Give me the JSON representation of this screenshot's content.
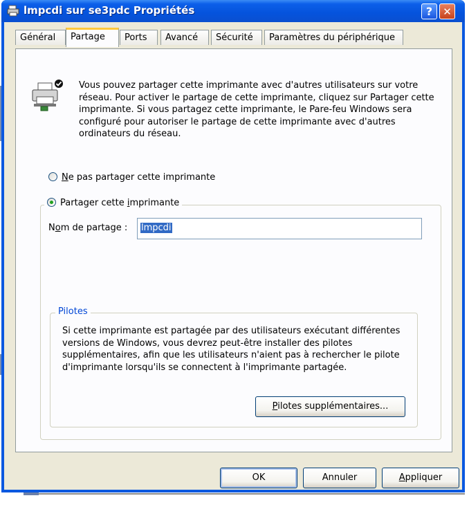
{
  "window": {
    "title": "lmpcdi sur se3pdc Propriétés",
    "help_label": "?",
    "close_label": "✕"
  },
  "tabs": [
    {
      "label": "Général",
      "active": false
    },
    {
      "label": "Partage",
      "active": true
    },
    {
      "label": "Ports",
      "active": false
    },
    {
      "label": "Avancé",
      "active": false
    },
    {
      "label": "Sécurité",
      "active": false
    },
    {
      "label": "Paramètres du périphérique",
      "active": false
    }
  ],
  "sharing": {
    "description": "Vous pouvez partager cette imprimante avec d'autres utilisateurs sur votre réseau. Pour activer le partage de cette imprimante, cliquez sur Partager cette imprimante.  Si vous partagez cette imprimante, le Pare-feu Windows sera configuré pour autoriser le partage de cette imprimante avec d'autres ordinateurs du réseau.",
    "no_share_mnemonic": "N",
    "no_share_rest": "e pas partager cette imprimante",
    "share_prefix": "Partager cette ",
    "share_mnemonic": "i",
    "share_suffix": "mprimante",
    "selected_option": "share",
    "share_name_prefix": "N",
    "share_name_mnemonic": "o",
    "share_name_suffix": "m de partage :",
    "share_name_value": "lmpcdi"
  },
  "drivers": {
    "legend": "Pilotes",
    "text": "Si cette imprimante est partagée par des utilisateurs exécutant différentes versions de Windows, vous devrez peut-être installer des pilotes supplémentaires, afin que les utilisateurs n'aient pas à rechercher le pilote d'imprimante lorsqu'ils se connectent à l'imprimante partagée.",
    "button_mnemonic": "P",
    "button_rest": "ilotes supplémentaires..."
  },
  "buttons": {
    "ok": "OK",
    "cancel": "Annuler",
    "apply_mnemonic": "A",
    "apply_rest": "ppliquer"
  },
  "colors": {
    "titlebar": "#0553dc",
    "dialog_bg": "#ece9d8",
    "selection": "#316ac5",
    "tab_highlight": "#ffc83c",
    "group_legend": "#0046d5"
  }
}
